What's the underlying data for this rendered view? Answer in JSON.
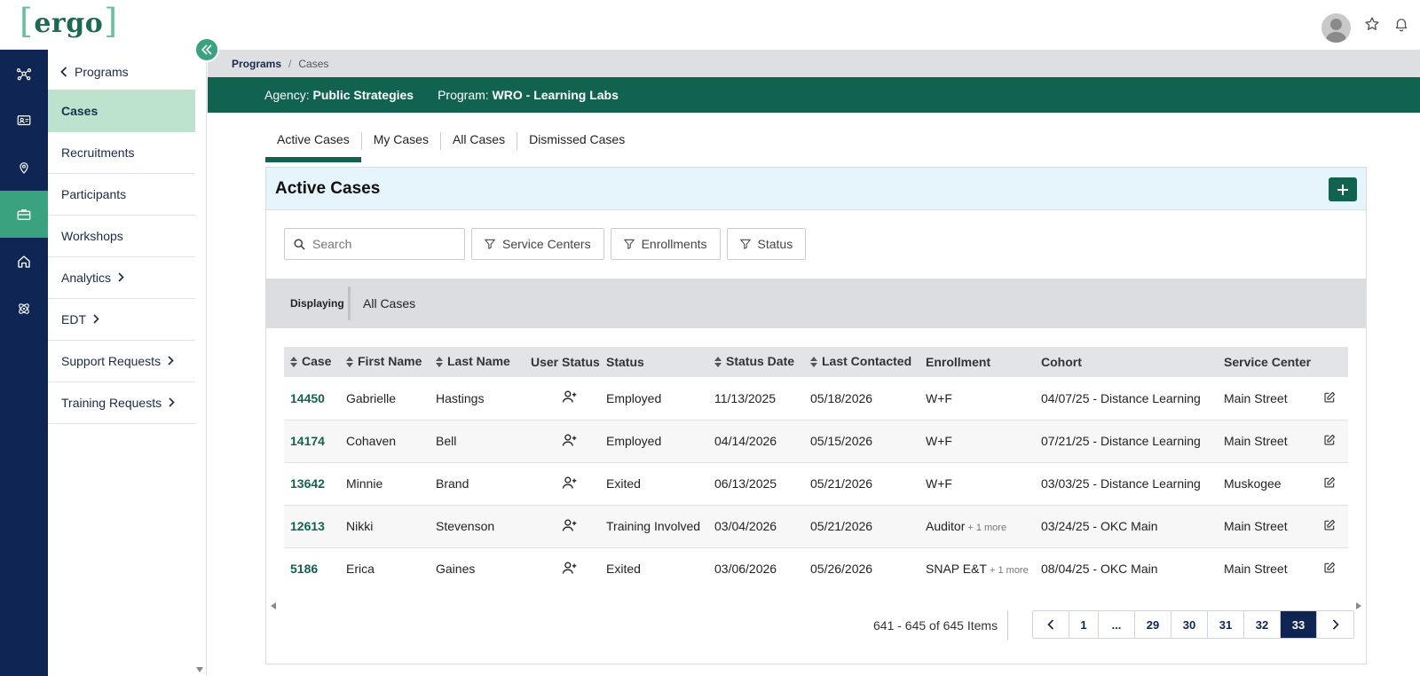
{
  "app": {
    "logo_text": "ergo",
    "logo_bracket_left": "[",
    "logo_bracket_right": "]"
  },
  "topbar": {
    "avatar": "user-avatar",
    "favorite_icon": "star-icon",
    "notifications_icon": "bell-icon"
  },
  "rail": {
    "items": [
      {
        "icon": "network-icon",
        "active": false
      },
      {
        "icon": "id-card-icon",
        "active": false
      },
      {
        "icon": "location-pin-icon",
        "active": false
      },
      {
        "icon": "briefcase-icon",
        "active": true
      },
      {
        "icon": "home-icon",
        "active": false
      },
      {
        "icon": "atom-icon",
        "active": false
      }
    ]
  },
  "subnav": {
    "back_label": "Programs",
    "items": [
      {
        "label": "Cases",
        "active": true,
        "has_chevron": false
      },
      {
        "label": "Recruitments",
        "active": false,
        "has_chevron": false
      },
      {
        "label": "Participants",
        "active": false,
        "has_chevron": false
      },
      {
        "label": "Workshops",
        "active": false,
        "has_chevron": false
      },
      {
        "label": "Analytics",
        "active": false,
        "has_chevron": true
      },
      {
        "label": "EDT",
        "active": false,
        "has_chevron": true
      },
      {
        "label": "Support Requests",
        "active": false,
        "has_chevron": true
      },
      {
        "label": "Training Requests",
        "active": false,
        "has_chevron": true
      }
    ]
  },
  "breadcrumb": {
    "root": "Programs",
    "separator": "/",
    "current": "Cases"
  },
  "context": {
    "agency_label": "Agency:",
    "agency_value": "Public Strategies",
    "program_label": "Program:",
    "program_value": "WRO - Learning Labs"
  },
  "tabs": [
    {
      "label": "Active Cases",
      "active": true
    },
    {
      "label": "My Cases",
      "active": false
    },
    {
      "label": "All Cases",
      "active": false
    },
    {
      "label": "Dismissed Cases",
      "active": false
    }
  ],
  "card": {
    "title": "Active Cases",
    "add_icon": "plus-icon"
  },
  "filters": {
    "search_placeholder": "Search",
    "buttons": [
      "Service Centers",
      "Enrollments",
      "Status"
    ]
  },
  "displaying": {
    "label": "Displaying",
    "value": "All Cases"
  },
  "table": {
    "columns": [
      {
        "label": "Case",
        "sortable": true
      },
      {
        "label": "First Name",
        "sortable": true
      },
      {
        "label": "Last Name",
        "sortable": true
      },
      {
        "label": "User Status",
        "sortable": false
      },
      {
        "label": "Status",
        "sortable": false
      },
      {
        "label": "Status Date",
        "sortable": true
      },
      {
        "label": "Last Contacted",
        "sortable": true
      },
      {
        "label": "Enrollment",
        "sortable": false
      },
      {
        "label": "Cohort",
        "sortable": false
      },
      {
        "label": "Service Center",
        "sortable": false
      },
      {
        "label": "",
        "sortable": false
      }
    ],
    "rows": [
      {
        "case": "14450",
        "first": "Gabrielle",
        "last": "Hastings",
        "status": "Employed",
        "status_date": "11/13/2025",
        "last_contacted": "05/18/2026",
        "enrollment": "W+F",
        "enrollment_more": "",
        "cohort": "04/07/25 - Distance Learning",
        "service_center": "Main Street"
      },
      {
        "case": "14174",
        "first": "Cohaven",
        "last": "Bell",
        "status": "Employed",
        "status_date": "04/14/2026",
        "last_contacted": "05/15/2026",
        "enrollment": "W+F",
        "enrollment_more": "",
        "cohort": "07/21/25 - Distance Learning",
        "service_center": "Main Street"
      },
      {
        "case": "13642",
        "first": "Minnie",
        "last": "Brand",
        "status": "Exited",
        "status_date": "06/13/2025",
        "last_contacted": "05/21/2026",
        "enrollment": "W+F",
        "enrollment_more": "",
        "cohort": "03/03/25 - Distance Learning",
        "service_center": "Muskogee"
      },
      {
        "case": "12613",
        "first": "Nikki",
        "last": "Stevenson",
        "status": "Training Involved",
        "status_date": "03/04/2026",
        "last_contacted": "05/21/2026",
        "enrollment": "Auditor",
        "enrollment_more": "+ 1 more",
        "cohort": "03/24/25 - OKC Main",
        "service_center": "Main Street"
      },
      {
        "case": "5186",
        "first": "Erica",
        "last": "Gaines",
        "status": "Exited",
        "status_date": "03/06/2026",
        "last_contacted": "05/26/2026",
        "enrollment": "SNAP E&T",
        "enrollment_more": "+ 1 more",
        "cohort": "08/04/25 - OKC Main",
        "service_center": "Main Street"
      }
    ]
  },
  "pagination": {
    "summary": "641 - 645 of 645 Items",
    "pages": [
      "1",
      "...",
      "29",
      "30",
      "31",
      "32",
      "33"
    ],
    "active_page": "33"
  },
  "colors": {
    "brand_green": "#116350",
    "accent_green": "#3aa27e",
    "navy": "#0f2553",
    "active_nav_bg": "#bde3cf"
  }
}
